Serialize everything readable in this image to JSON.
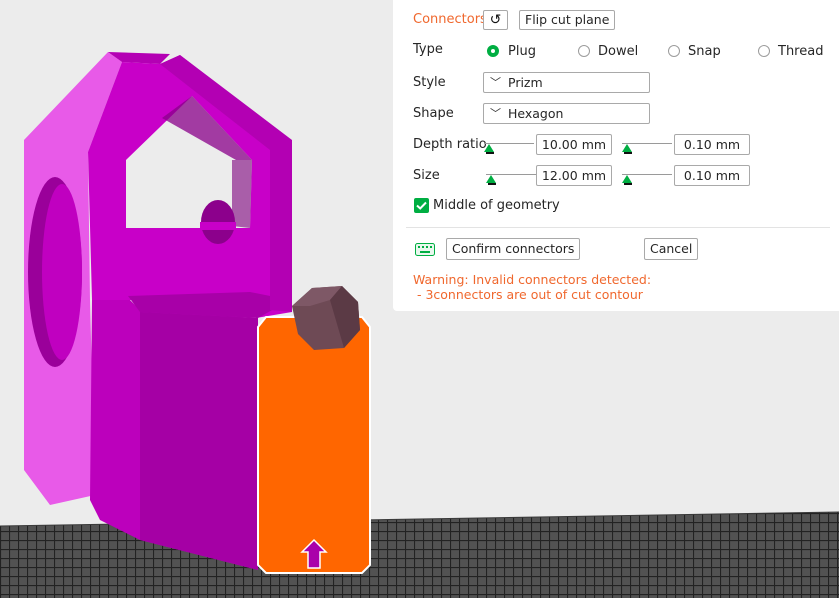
{
  "connectors": {
    "title": "Connectors",
    "flip_label": "Flip cut plane",
    "type": {
      "label": "Type",
      "options": [
        "Plug",
        "Dowel",
        "Snap",
        "Thread"
      ],
      "selected": "Plug"
    },
    "style": {
      "label": "Style",
      "value": "Prizm"
    },
    "shape": {
      "label": "Shape",
      "value": "Hexagon"
    },
    "depth": {
      "label": "Depth ratio",
      "value": "10.00",
      "unit": "mm",
      "tolerance": "0.10",
      "tolerance_unit": "mm"
    },
    "size": {
      "label": "Size",
      "value": "12.00",
      "unit": "mm",
      "tolerance": "0.10",
      "tolerance_unit": "mm"
    },
    "middle": {
      "label": "Middle of geometry",
      "checked": true
    },
    "confirm_label": "Confirm connectors",
    "cancel_label": "Cancel",
    "warning": {
      "line1": "Warning: Invalid connectors detected:",
      "line2": " - 3connectors are out of cut contour"
    }
  },
  "colors": {
    "accent": "#00ae42",
    "warning": "#f0682e",
    "model_magenta": "#cc00cc",
    "cut_part_orange": "#ff6600",
    "connector": "#6e4a55"
  },
  "icons": [
    "rotate-ccw-icon",
    "keyboard-icon",
    "chevron-down-icon",
    "check-icon"
  ]
}
